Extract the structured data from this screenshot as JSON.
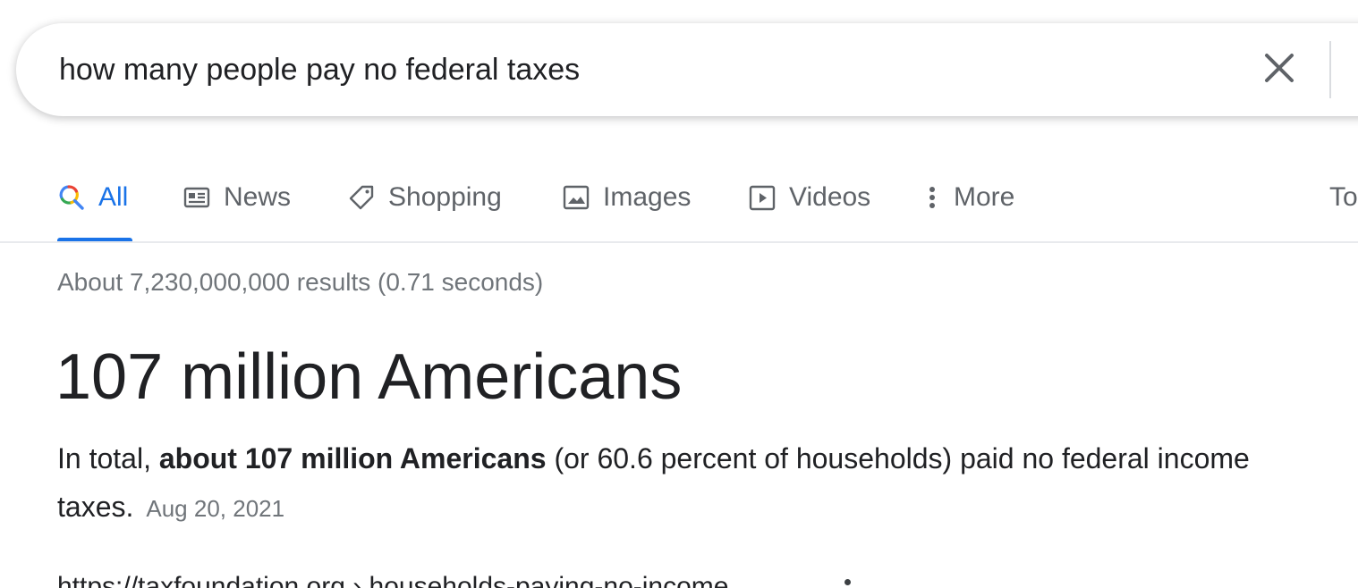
{
  "search": {
    "query": "how many people pay no federal taxes",
    "clear_icon": "close-icon"
  },
  "tabs": [
    {
      "label": "All",
      "icon": "search-icon",
      "active": true
    },
    {
      "label": "News",
      "icon": "news-icon"
    },
    {
      "label": "Shopping",
      "icon": "tag-icon"
    },
    {
      "label": "Images",
      "icon": "image-icon"
    },
    {
      "label": "Videos",
      "icon": "play-icon"
    },
    {
      "label": "More",
      "icon": "more-vert-icon"
    },
    {
      "label": "To"
    }
  ],
  "result_stats": "About 7,230,000,000 results (0.71 seconds)",
  "answer": {
    "title": "107 million Americans",
    "snippet_prefix": "In total, ",
    "snippet_bold": "about 107 million Americans",
    "snippet_suffix": " (or 60.6 percent of households) paid no federal income taxes.",
    "date": "Aug 20, 2021"
  },
  "cut_url": "https://taxfoundation.org › households-paying-no-income",
  "colors": {
    "accent": "#1a73e8",
    "text": "#202124",
    "secondary": "#5f6368",
    "meta": "#70757a"
  }
}
